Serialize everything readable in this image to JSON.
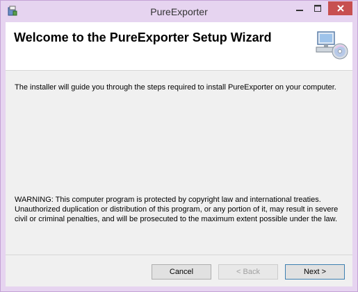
{
  "window": {
    "title": "PureExporter",
    "icon": "installer-icon"
  },
  "banner": {
    "title": "Welcome to the PureExporter Setup Wizard",
    "icon": "computer-cd-icon"
  },
  "body": {
    "intro": "The installer will guide you through the steps required to install PureExporter on your computer.",
    "warning": "WARNING: This computer program is protected by copyright law and international treaties. Unauthorized duplication or distribution of this program, or any portion of it, may result in severe civil or criminal penalties, and will be prosecuted to the maximum extent possible under the law."
  },
  "buttons": {
    "cancel": "Cancel",
    "back": "< Back",
    "next": "Next >"
  },
  "colors": {
    "title_bar": "#e6d4f0",
    "close_button": "#c75050",
    "client_background": "#f0f0f0",
    "default_button_border": "#3c7fb1"
  }
}
